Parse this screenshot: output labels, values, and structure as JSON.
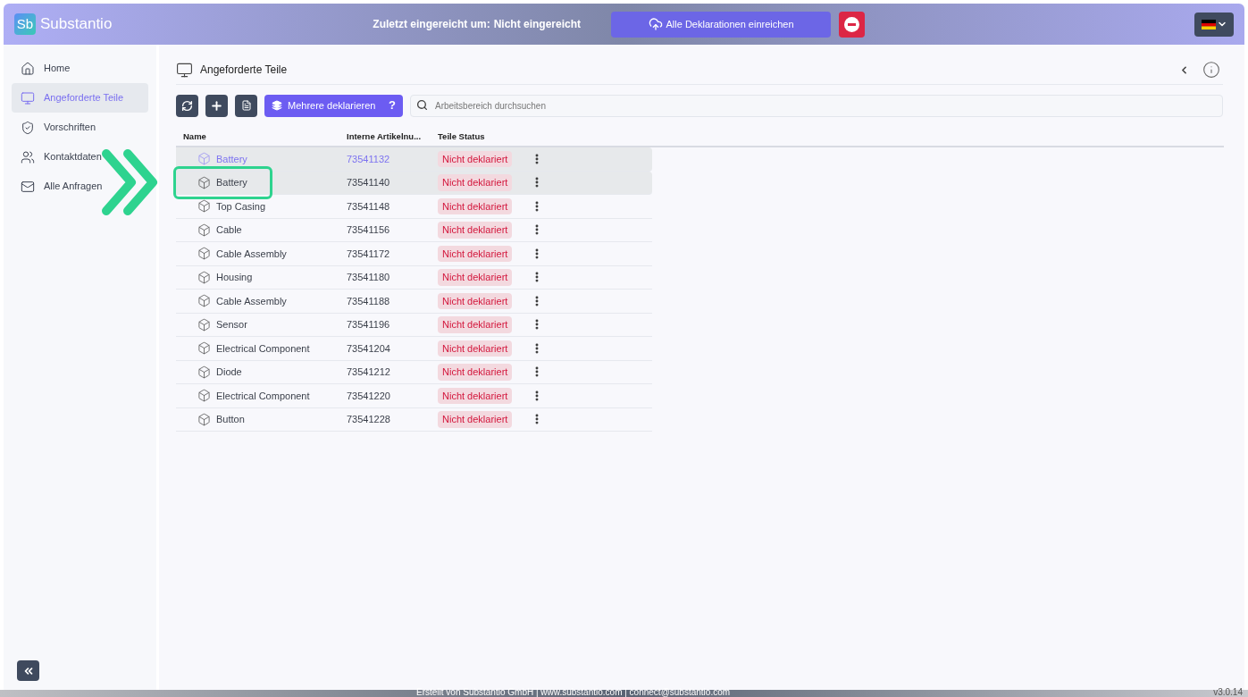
{
  "header": {
    "logo_mark": "Sb",
    "app_name": "Substantio",
    "last_submitted_label": "Zuletzt eingereicht um:",
    "last_submitted_value": "Nicht eingereicht",
    "submit_all_button": "Alle Deklarationen einreichen"
  },
  "sidebar": {
    "items": [
      {
        "label": "Home",
        "selected": false
      },
      {
        "label": "Angeforderte Teile",
        "selected": true
      },
      {
        "label": "Vorschriften",
        "selected": false
      },
      {
        "label": "Kontaktdaten",
        "selected": false
      },
      {
        "label": "Alle Anfragen",
        "selected": false
      }
    ]
  },
  "page": {
    "title": "Angeforderte Teile",
    "declare_many_button": "Mehrere deklarieren",
    "help_mark": "?",
    "search": {
      "placeholder": "Arbeitsbereich durchsuchen"
    }
  },
  "table": {
    "columns": [
      "Name",
      "Interne Artikelnu...",
      "Teile Status"
    ],
    "rows": [
      {
        "name": "Battery",
        "number": "73541132",
        "status": "Nicht deklariert",
        "hovered": true,
        "highlighted": true
      },
      {
        "name": "Battery",
        "number": "73541140",
        "status": "Nicht deklariert",
        "hovered": false,
        "highlighted": true
      },
      {
        "name": "Top Casing",
        "number": "73541148",
        "status": "Nicht deklariert",
        "hovered": false,
        "highlighted": false
      },
      {
        "name": "Cable",
        "number": "73541156",
        "status": "Nicht deklariert",
        "hovered": false,
        "highlighted": false
      },
      {
        "name": "Cable Assembly",
        "number": "73541172",
        "status": "Nicht deklariert",
        "hovered": false,
        "highlighted": false
      },
      {
        "name": "Housing",
        "number": "73541180",
        "status": "Nicht deklariert",
        "hovered": false,
        "highlighted": false
      },
      {
        "name": "Cable Assembly",
        "number": "73541188",
        "status": "Nicht deklariert",
        "hovered": false,
        "highlighted": false
      },
      {
        "name": "Sensor",
        "number": "73541196",
        "status": "Nicht deklariert",
        "hovered": false,
        "highlighted": false
      },
      {
        "name": "Electrical Component",
        "number": "73541204",
        "status": "Nicht deklariert",
        "hovered": false,
        "highlighted": false
      },
      {
        "name": "Diode",
        "number": "73541212",
        "status": "Nicht deklariert",
        "hovered": false,
        "highlighted": false
      },
      {
        "name": "Electrical Component",
        "number": "73541220",
        "status": "Nicht deklariert",
        "hovered": false,
        "highlighted": false
      },
      {
        "name": "Button",
        "number": "73541228",
        "status": "Nicht deklariert",
        "hovered": false,
        "highlighted": false
      }
    ]
  },
  "footer": {
    "text": "Erstellt von Substantio GmbH | www.substantio.com | connect@substantio.com",
    "version": "v3.0.14"
  }
}
